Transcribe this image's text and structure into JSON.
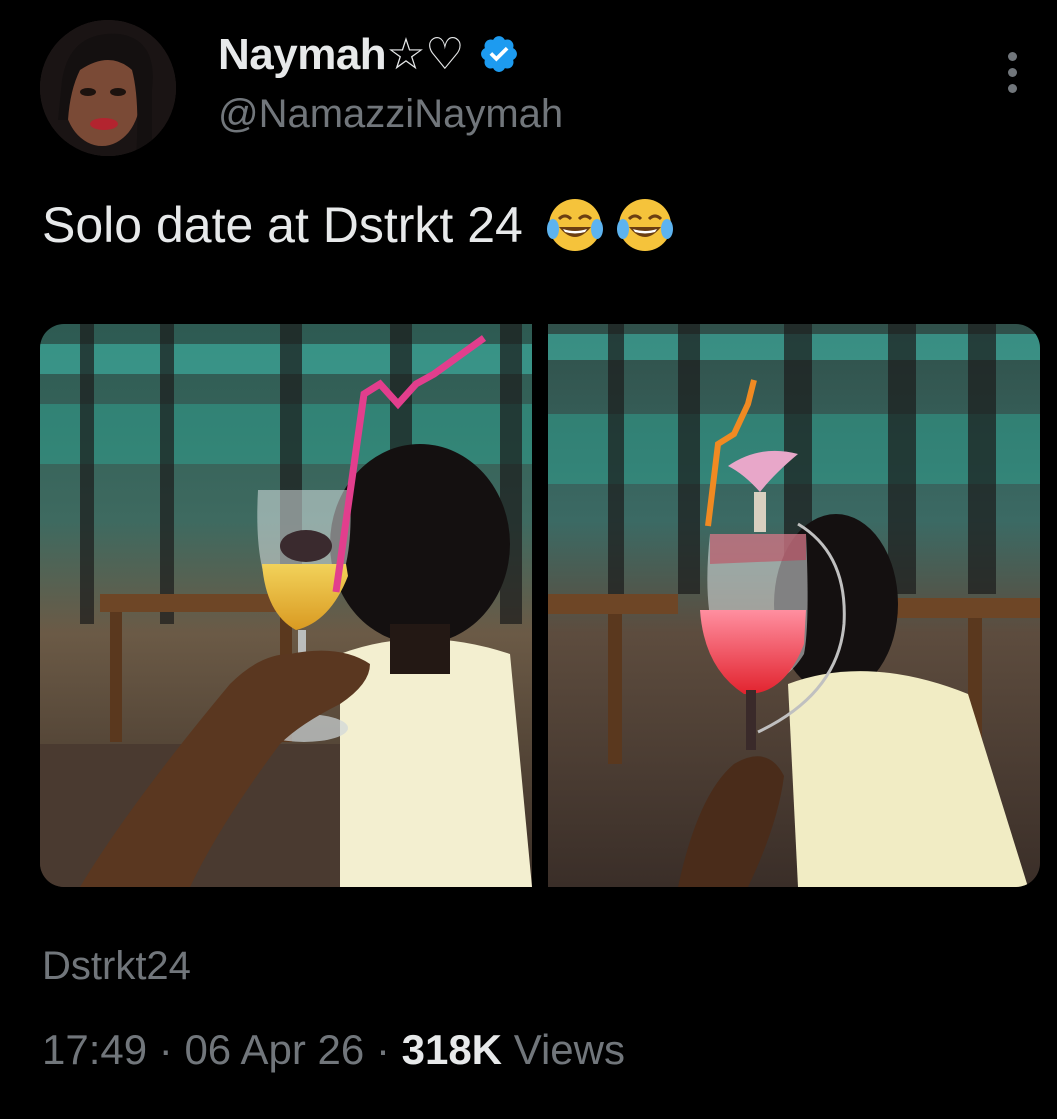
{
  "user": {
    "display_name": "Naymah☆♡",
    "handle": "@NamazziNaymah",
    "verified": true,
    "verified_color": "#1d9bf0",
    "avatar_icon": "profile-photo"
  },
  "tweet": {
    "text": "Solo date at Dstrkt 24",
    "emojis": [
      "face-with-tears-of-joy-icon",
      "face-with-tears-of-joy-icon"
    ]
  },
  "media": [
    {
      "label": "photo-yellow-cocktail"
    },
    {
      "label": "photo-red-cocktail"
    }
  ],
  "location": "Dstrkt24",
  "meta": {
    "time": "17:49",
    "separator": "·",
    "date": "06 Apr 26",
    "views_count": "318K",
    "views_label": "Views"
  },
  "colors": {
    "background": "#000000",
    "primary_text": "#e7e9ea",
    "secondary_text": "#71767b",
    "accent": "#1d9bf0"
  }
}
